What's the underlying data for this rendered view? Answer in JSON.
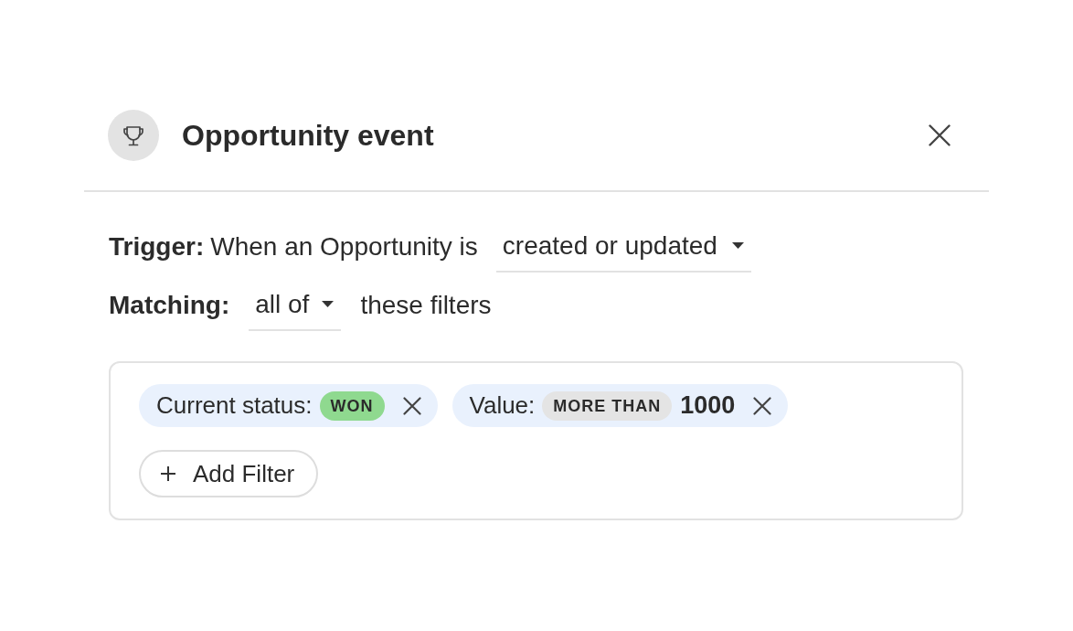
{
  "header": {
    "title": "Opportunity event"
  },
  "trigger": {
    "label": "Trigger:",
    "text": "When an Opportunity is",
    "dropdown": {
      "value": "created or updated"
    }
  },
  "matching": {
    "label": "Matching:",
    "dropdown": {
      "value": "all of"
    },
    "text": "these filters"
  },
  "filters": [
    {
      "label": "Current status:",
      "tokens": [
        {
          "kind": "tag",
          "text": "WON",
          "color": "#8fd98f"
        }
      ]
    },
    {
      "label": "Value:",
      "tokens": [
        {
          "kind": "tag",
          "text": "MORE THAN",
          "color": "#e4e4e4"
        },
        {
          "kind": "value",
          "text": "1000"
        }
      ]
    }
  ],
  "add_filter": {
    "label": "Add Filter"
  }
}
